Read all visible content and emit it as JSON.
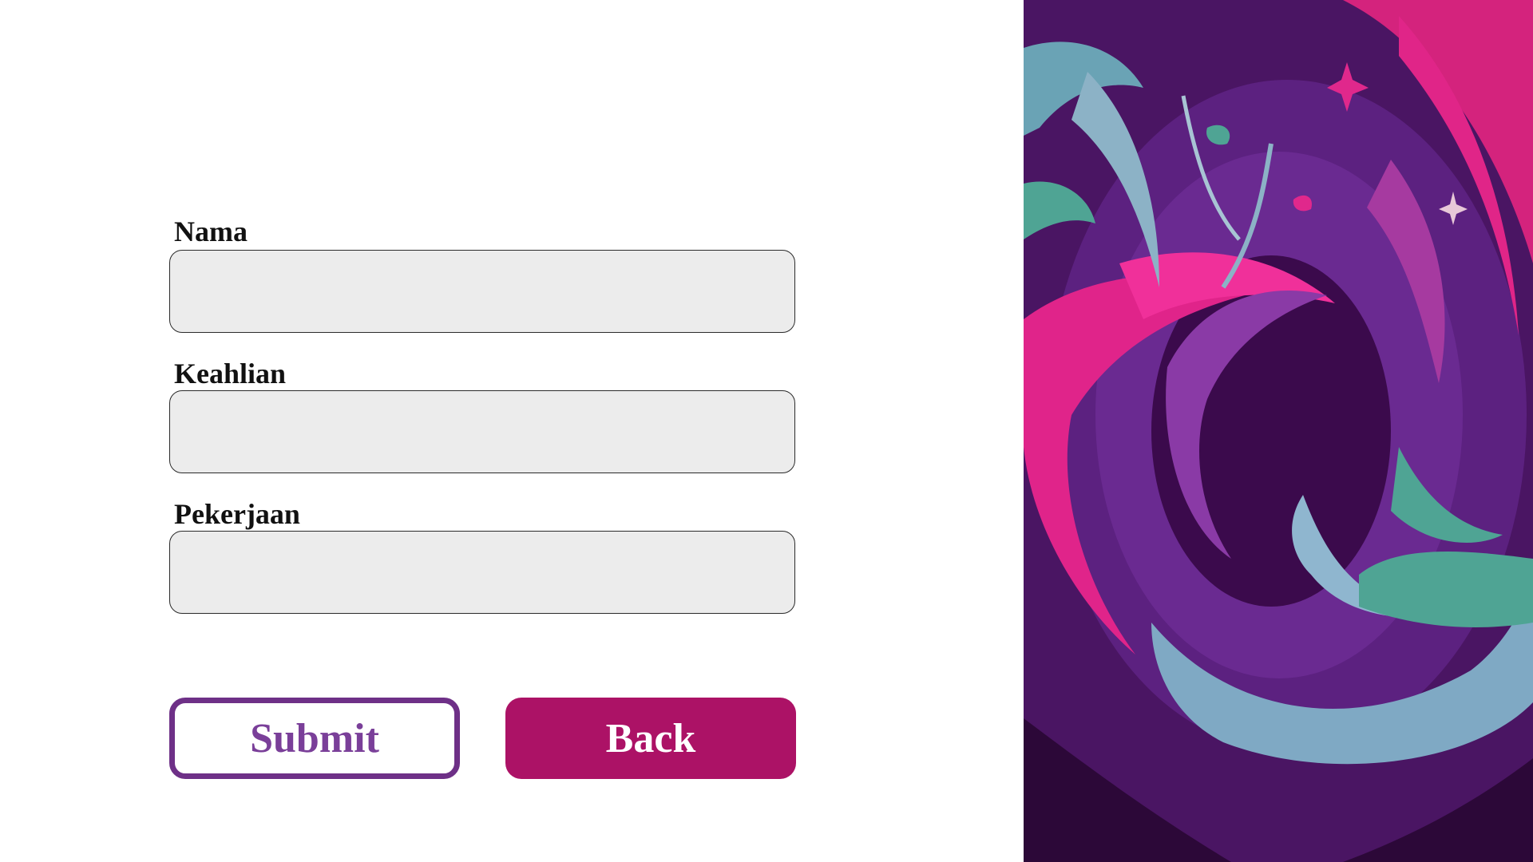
{
  "form": {
    "fields": [
      {
        "label": "Nama",
        "value": "",
        "placeholder": ""
      },
      {
        "label": "Keahlian",
        "value": "",
        "placeholder": ""
      },
      {
        "label": "Pekerjaan",
        "value": "",
        "placeholder": ""
      }
    ],
    "submit_label": "Submit",
    "back_label": "Back"
  },
  "colors": {
    "submit_border": "#6e3087",
    "submit_text": "#7a3f99",
    "back_background": "#ac1266",
    "input_background": "#ececec"
  },
  "decor": {
    "image": "abstract-swirl-artwork"
  }
}
